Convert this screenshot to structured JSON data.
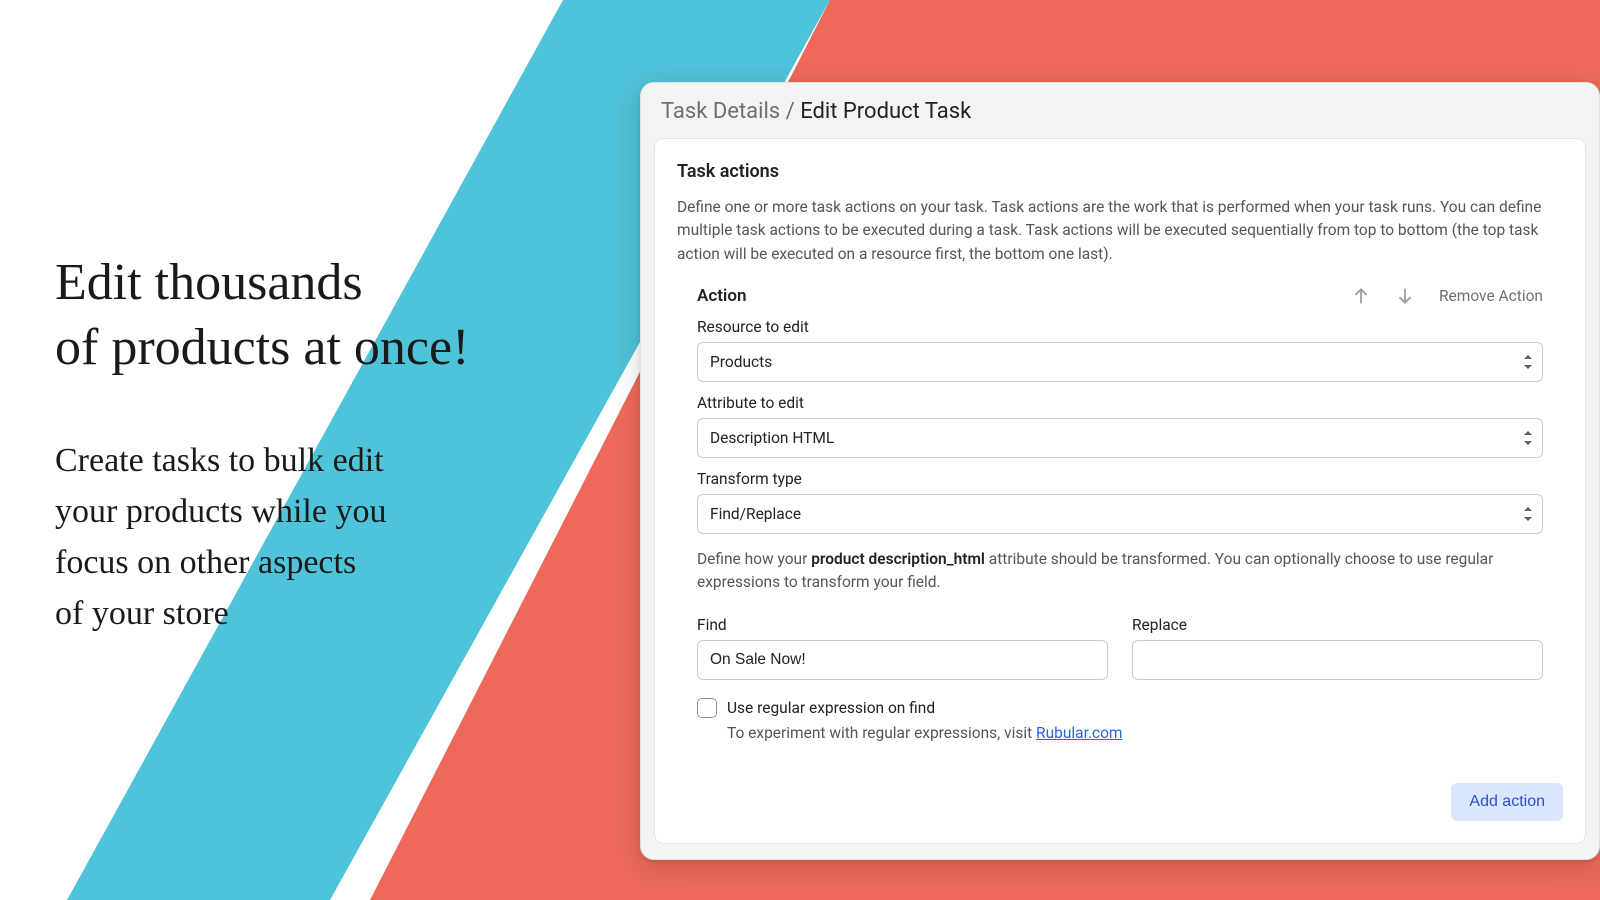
{
  "marketing": {
    "headline_1": "Edit thousands",
    "headline_2": "of products at once!",
    "sub_1": "Create tasks to bulk edit",
    "sub_2": "your products while you",
    "sub_3": "focus on other aspects",
    "sub_4": "of your store"
  },
  "breadcrumb": {
    "parent": "Task Details",
    "sep": "/",
    "current": "Edit Product Task"
  },
  "panel": {
    "title": "Task actions",
    "description": "Define one or more task actions on your task. Task actions are the work that is performed when your task runs. You can define multiple task actions to be executed during a task. Task actions will be executed sequentially from top to bottom (the top task action will be executed on a resource first, the bottom one last).",
    "action_title": "Action",
    "remove_label": "Remove Action",
    "resource_label": "Resource to edit",
    "resource_value": "Products",
    "attribute_label": "Attribute to edit",
    "attribute_value": "Description HTML",
    "transform_label": "Transform type",
    "transform_value": "Find/Replace",
    "transform_desc_pre": "Define how your ",
    "transform_desc_bold": "product description_html",
    "transform_desc_post": " attribute should be transformed. You can optionally choose to use regular expressions to transform your field.",
    "find_label": "Find",
    "find_value": "On Sale Now!",
    "replace_label": "Replace",
    "replace_value": "",
    "regex_label": "Use regular expression on find",
    "regex_hint_pre": "To experiment with regular expressions, visit ",
    "regex_hint_link": "Rubular.com",
    "add_action": "Add action"
  }
}
